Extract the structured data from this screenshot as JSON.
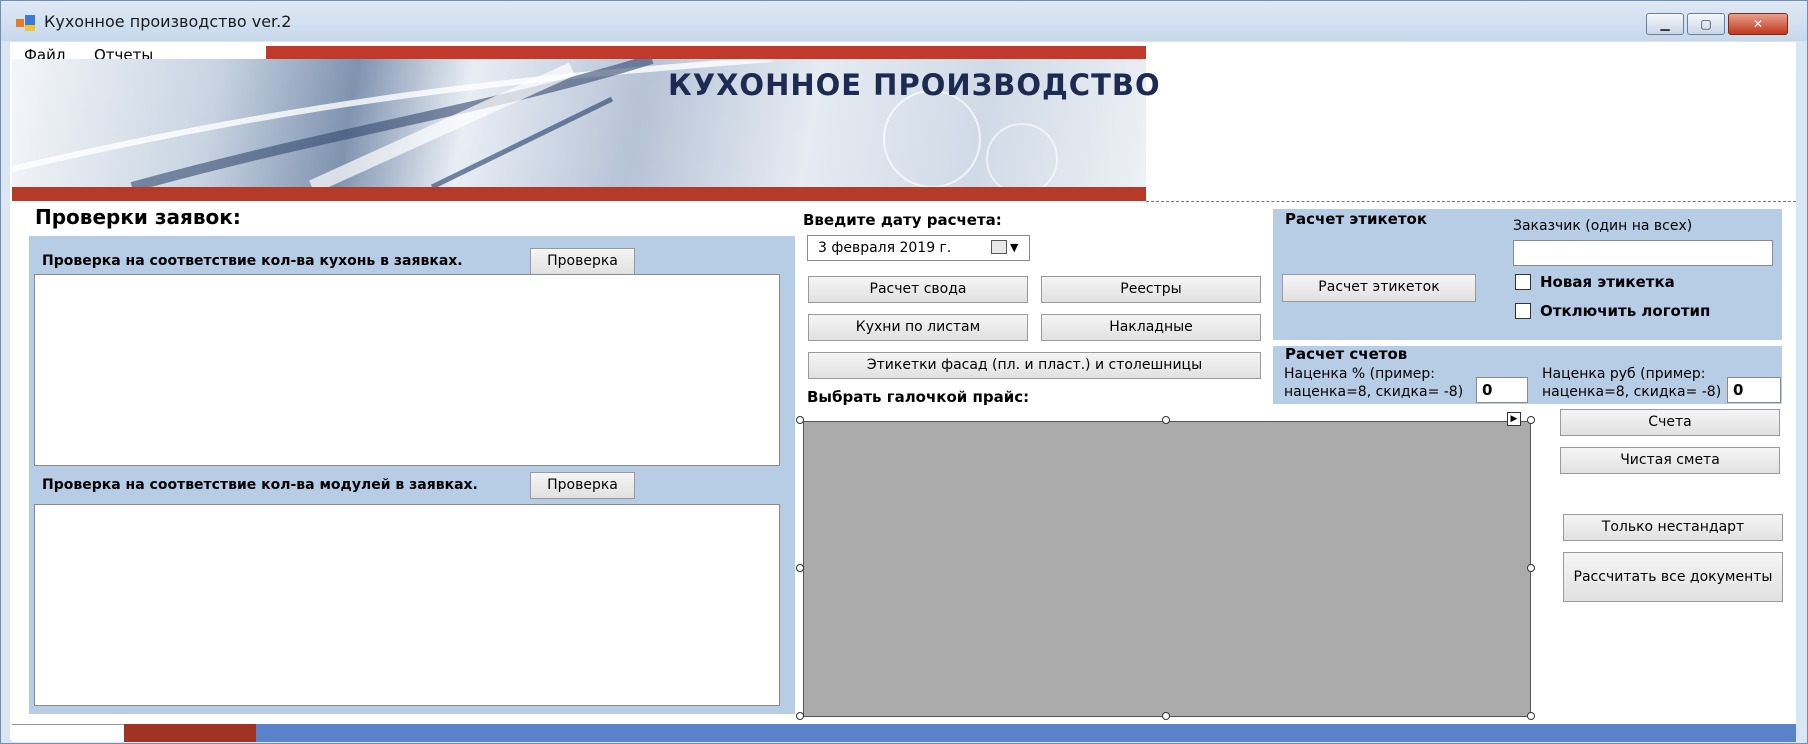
{
  "window": {
    "title": "Кухонное производство ver.2",
    "min_label": "▁",
    "max_label": "▢",
    "close_label": "✕"
  },
  "menu": {
    "file": "Файл",
    "reports": "Отчеты"
  },
  "banner": {
    "title": "КУХОННОЕ ПРОИЗВОДСТВО"
  },
  "checks": {
    "heading": "Проверки заявок:",
    "kitchens_label": "Проверка на соответствие кол-ва кухонь в заявках.",
    "kitchens_button": "Проверка",
    "modules_label": "Проверка на соответствие кол-ва модулей в заявках.",
    "modules_button": "Проверка"
  },
  "date": {
    "label": "Введите дату расчета:",
    "value": "3 февраля  2019 г."
  },
  "actions": {
    "svod": "Расчет свода",
    "registry": "Реестры",
    "kitchens_by_sheets": "Кухни по листам",
    "invoices": "Накладные",
    "labels_facade": "Этикетки фасад (пл. и пласт.) и столешницы",
    "price_label": "Выбрать галочкой прайс:"
  },
  "labels_panel": {
    "title": "Расчет этикеток",
    "customer_label": "Заказчик  (один на всех)",
    "customer_value": "",
    "calc_button": "Расчет этикеток",
    "new_label": "Новая этикетка",
    "disable_logo": "Отключить логотип"
  },
  "accounts_panel": {
    "title": "Расчет счетов",
    "markup_pct_label_1": "Наценка % (пример:",
    "markup_pct_label_2": "наценка=8, скидка= -8)",
    "markup_pct_value": "0",
    "markup_rub_label_1": "Наценка руб (пример:",
    "markup_rub_label_2": "наценка=8, скидка= -8)",
    "markup_rub_value": "0"
  },
  "side_buttons": {
    "accounts": "Счета",
    "clean_estimate": "Чистая смета",
    "only_nonstandard": "Только нестандарт",
    "calc_all": "Рассчитать все документы"
  },
  "colors": {
    "panel_blue": "#b7cde6",
    "banner_red": "#c0392b",
    "status_blue": "#5a82c8"
  }
}
